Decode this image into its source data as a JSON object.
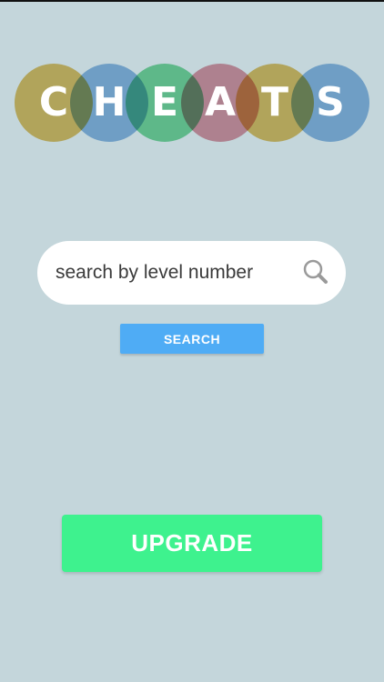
{
  "logo": {
    "letters": [
      {
        "char": "C",
        "color": "#e6c36a"
      },
      {
        "char": "H",
        "color": "#90bde6"
      },
      {
        "char": "E",
        "color": "#7adba0"
      },
      {
        "char": "A",
        "color": "#e29aa6"
      },
      {
        "char": "T",
        "color": "#e6c36a"
      },
      {
        "char": "S",
        "color": "#90bde6"
      }
    ]
  },
  "search": {
    "placeholder": "search by level number",
    "value": "",
    "icon": "search-icon",
    "button_label": "SEARCH",
    "button_color": "#4facf5"
  },
  "upgrade": {
    "label": "UPGRADE",
    "color": "#3ef28e"
  },
  "background_color": "#c4d6db"
}
